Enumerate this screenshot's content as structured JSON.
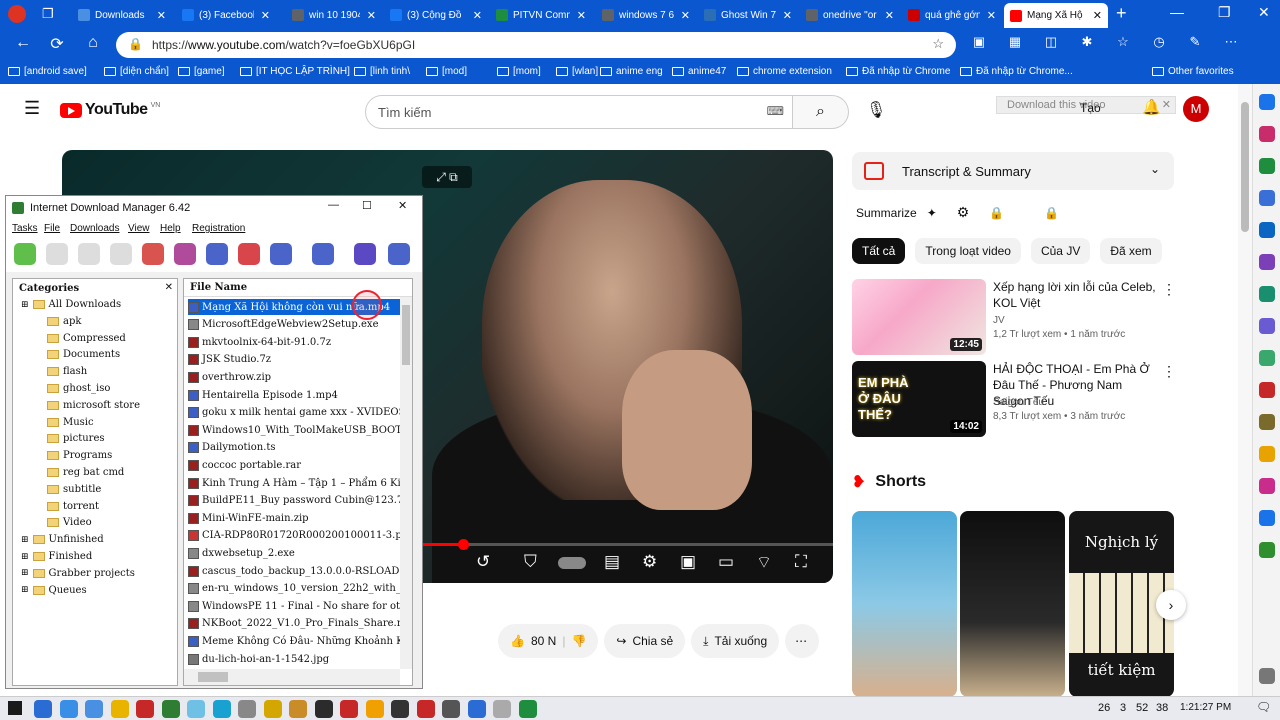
{
  "browser": {
    "tabs": [
      {
        "label": "Downloads",
        "color": "#4a90e2"
      },
      {
        "label": "(3) Facebook",
        "color": "#1877f2"
      },
      {
        "label": "win 10 1904",
        "color": "#5f6368"
      },
      {
        "label": "(3) Cộng Đồ",
        "color": "#1877f2"
      },
      {
        "label": "PITVN Comm",
        "color": "#1e8e3e"
      },
      {
        "label": "windows 7 6",
        "color": "#5f6368"
      },
      {
        "label": "Ghost Win 7",
        "color": "#2a6fb5"
      },
      {
        "label": "onedrive \"or",
        "color": "#5f6368"
      },
      {
        "label": "quá ghê gớn",
        "color": "#c00"
      },
      {
        "label": "Mạng Xã Hộ",
        "color": "#f00"
      }
    ],
    "url_prefix": "https://",
    "url_host": "www.youtube.com",
    "url_path": "/watch?v=foeGbXU6pGI",
    "bookmarks": [
      "[android save]",
      "[diện chẩn]",
      "[game]",
      "[IT HỌC LẬP TRÌNH]",
      "[linh tinh\\",
      "[mod]",
      "[mom]",
      "[wlan]",
      "anime eng",
      "anime47",
      "chrome extension",
      "Đã nhập từ Chrome",
      "Đã nhập từ Chrome..."
    ],
    "other_favorites": "Other favorites"
  },
  "youtube": {
    "logo": "YouTube",
    "region": "VN",
    "search_placeholder": "Tìm kiếm",
    "download_video": "Download this video",
    "create": "Tạo",
    "avatar": "M",
    "likes": "80 N",
    "share": "Chia sẻ",
    "download": "Tải xuống",
    "transcript": "Transcript & Summary",
    "summarize": "Summarize",
    "chips": [
      "Tất cả",
      "Trong loạt video",
      "Của JV",
      "Đã xem"
    ],
    "recs": [
      {
        "title": "Xếp hạng lời xin lỗi của Celeb, KOL Việt",
        "channel": "JV",
        "meta": "1,2 Tr lượt xem • 1 năm trước",
        "duration": "12:45"
      },
      {
        "title": "HẢI ĐỘC THOẠI - Em Phà Ở Đâu Thế - Phương Nam Saigon Tếu",
        "channel": "Saigon Tếu",
        "meta": "8,3 Tr lượt xem • 3 năm trước",
        "duration": "14:02",
        "thumb_text": "EM PHÀ Ở ĐÂU THẾ?"
      }
    ],
    "shorts_title": "Shorts",
    "short3_top": "Nghịch lý",
    "short3_bottom": "tiết kiệm",
    "progress": 0.52
  },
  "idm": {
    "title": "Internet Download Manager 6.42",
    "menu": [
      "Tasks",
      "File",
      "Downloads",
      "View",
      "Help",
      "Registration"
    ],
    "categories_header": "Categories",
    "categories": [
      {
        "label": "All Downloads",
        "level": 0
      },
      {
        "label": "apk",
        "level": 1
      },
      {
        "label": "Compressed",
        "level": 1
      },
      {
        "label": "Documents",
        "level": 1
      },
      {
        "label": "flash",
        "level": 1
      },
      {
        "label": "ghost_iso",
        "level": 1
      },
      {
        "label": "microsoft store",
        "level": 1
      },
      {
        "label": "Music",
        "level": 1
      },
      {
        "label": "pictures",
        "level": 1
      },
      {
        "label": "Programs",
        "level": 1
      },
      {
        "label": "reg bat cmd",
        "level": 1
      },
      {
        "label": "subtitle",
        "level": 1
      },
      {
        "label": "torrent",
        "level": 1
      },
      {
        "label": "Video",
        "level": 1
      },
      {
        "label": "Unfinished",
        "level": 0
      },
      {
        "label": "Finished",
        "level": 0
      },
      {
        "label": "Grabber projects",
        "level": 0
      },
      {
        "label": "Queues",
        "level": 0
      }
    ],
    "file_header": "File Name",
    "files": [
      "Mạng Xã Hội không còn vui nữa.mp4",
      "MicrosoftEdgeWebview2Setup.exe",
      "mkvtoolnix-64-bit-91.0.7z",
      "JSK Studio.7z",
      "overthrow.zip",
      "Hentairella Episode 1.mp4",
      "goku x milk hentai game xxx - XVIDEOS.",
      "Windows10_With_ToolMakeUSB_BOOT.r",
      "Dailymotion.ts",
      "coccoc portable.rar",
      "Kinh Trung A Hàm – Tập 1 – Phẩm 6 Kin",
      "BuildPE11_Buy password Cubin@123.7z",
      "Mini-WinFE-main.zip",
      "CIA-RDP80R01720R000200100011-3.pdf",
      "dxwebsetup_2.exe",
      "cascus_todo_backup_13.0.0.0-RSLOAD.N",
      "en-ru_windows_10_version_22h2_with_upc",
      "WindowsPE 11 - Final - No share for other",
      "NKBoot_2022_V1.0_Pro_Finals_Share.rar",
      "Meme Không Có Đâu- Những Khoảnh Khắc",
      "du-lich-hoi-an-1-1542.jpg"
    ]
  },
  "taskbar": {
    "time": "1:21:27 PM",
    "n1": "26",
    "n2": "3",
    "n3": "52",
    "n4": "38"
  }
}
